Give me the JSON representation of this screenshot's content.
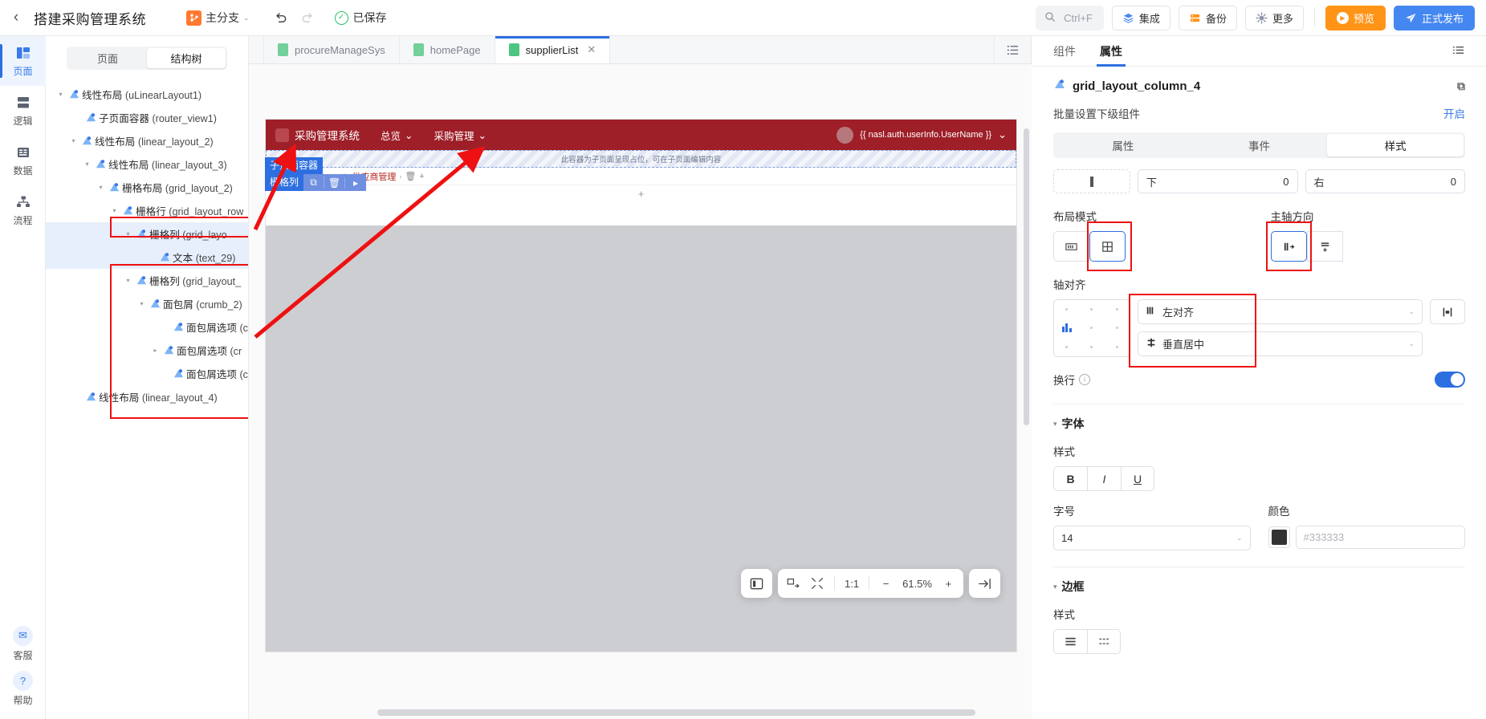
{
  "topbar": {
    "back_icon": "chevron-left-icon",
    "project_title": "搭建采购管理系统",
    "branch_label": "主分支",
    "branch_caret": "⌄",
    "undo_icon": "↺",
    "redo_icon": "↻",
    "saved_label": "已保存",
    "saved_check": "✓",
    "search": {
      "icon": "search-icon",
      "shortcut": "Ctrl+F"
    },
    "buttons": [
      {
        "name": "integration",
        "label": "集成"
      },
      {
        "name": "backup",
        "label": "备份"
      },
      {
        "name": "more",
        "label": "更多"
      }
    ],
    "preview_label": "预览",
    "publish_label": "正式发布"
  },
  "rail": {
    "items": [
      {
        "label": "页面",
        "icon": "pages-icon",
        "active": true
      },
      {
        "label": "逻辑",
        "icon": "logic-icon",
        "active": false
      },
      {
        "label": "数据",
        "icon": "data-icon",
        "active": false
      },
      {
        "label": "流程",
        "icon": "flow-icon",
        "active": false
      }
    ],
    "bottom": [
      {
        "label": "客服",
        "icon": "support-icon"
      },
      {
        "label": "帮助",
        "icon": "help-icon"
      }
    ]
  },
  "tree_panel": {
    "tabs": [
      {
        "label": "页面",
        "active": false
      },
      {
        "label": "结构树",
        "active": true
      }
    ],
    "nodes": [
      {
        "indent": 0,
        "twisty": "▾",
        "label": "线性布局",
        "id": "(uLinearLayout1)",
        "selected": false
      },
      {
        "indent": 1,
        "twisty": "",
        "label": "子页面容器",
        "id": "(router_view1)",
        "selected": false
      },
      {
        "indent": 1,
        "twisty": "▾",
        "label": "线性布局",
        "id": "(linear_layout_2)",
        "selected": false
      },
      {
        "indent": 2,
        "twisty": "▾",
        "label": "线性布局",
        "id": "(linear_layout_3)",
        "selected": false
      },
      {
        "indent": 3,
        "twisty": "▾",
        "label": "栅格布局",
        "id": "(grid_layout_2)",
        "selected": false
      },
      {
        "indent": 4,
        "twisty": "▾",
        "label": "栅格行",
        "id": "(grid_layout_row",
        "selected": false
      },
      {
        "indent": 5,
        "twisty": "▾",
        "label": "栅格列",
        "id": "(grid_layo",
        "selected": true
      },
      {
        "indent": 6,
        "twisty": "",
        "label": "文本",
        "id": "(text_29)",
        "selected": true
      },
      {
        "indent": 5,
        "twisty": "▾",
        "label": "栅格列",
        "id": "(grid_layout_",
        "selected": false
      },
      {
        "indent": 6,
        "twisty": "▾",
        "label": "面包屑",
        "id": "(crumb_2)",
        "selected": false
      },
      {
        "indent": 7,
        "twisty": "",
        "label": "面包屑选项",
        "id": "(cr",
        "selected": false
      },
      {
        "indent": 7,
        "twisty": "▸",
        "label": "面包屑选项",
        "id": "(cr",
        "selected": false
      },
      {
        "indent": 7,
        "twisty": "",
        "label": "面包屑选项",
        "id": "(cr",
        "selected": false
      },
      {
        "indent": 1,
        "twisty": "",
        "label": "线性布局",
        "id": "(linear_layout_4)",
        "selected": false
      }
    ]
  },
  "file_tabs": {
    "items": [
      {
        "label": "procureManageSys",
        "active": false,
        "closable": false
      },
      {
        "label": "homePage",
        "active": false,
        "closable": false
      },
      {
        "label": "supplierList",
        "active": true,
        "closable": true,
        "close_icon": "close-icon"
      }
    ],
    "list_icon": "list-view-icon"
  },
  "canvas": {
    "app_nav": {
      "brand": "采购管理系统",
      "links": [
        {
          "label": "总览",
          "caret": "⌄"
        },
        {
          "label": "采购管理",
          "caret": "⌄"
        }
      ],
      "user_expr": "{{ nasl.auth.userInfo.UserName }}",
      "user_caret": "⌄"
    },
    "router_placeholder_text": "此容器为子页面呈现占位，可在子页面编辑内容",
    "overlay_badges": {
      "router_view": "子页面容器",
      "grid_column": "栅格列"
    },
    "toolstrip_icons": [
      "copy-icon",
      "delete-icon",
      "more-arrow-icon"
    ],
    "breadcrumb": {
      "chip": "采购管理",
      "items": [
        "供应商管理"
      ],
      "home_icon": "home-icon",
      "person_icon": "person-icon",
      "trash_icon": "trash-icon",
      "plus": "+",
      "sep": "›"
    },
    "add_row_plus": "+",
    "zoom_toolbar": {
      "panel_icon": "panel-toggle-icon",
      "fit_icon": "fit-screen-icon",
      "collapse_icon": "collapse-icon",
      "ratio_label": "1:1",
      "minus": "−",
      "zoom_level": "61.5%",
      "plus": "+",
      "expand_icon": "expand-right-icon"
    }
  },
  "right_panel": {
    "tabs": [
      {
        "label": "组件",
        "active": false
      },
      {
        "label": "属性",
        "active": true
      }
    ],
    "collapse_icon": "collapse-panel-icon",
    "component_name": "grid_layout_column_4",
    "copy_icon": "copy-icon",
    "batch_label": "批量设置下级组件",
    "batch_action": "开启",
    "subtabs": [
      {
        "label": "属性",
        "active": false
      },
      {
        "label": "事件",
        "active": false
      },
      {
        "label": "样式",
        "active": true
      }
    ],
    "padding": [
      {
        "label": "下",
        "value": "0"
      },
      {
        "label": "右",
        "value": "0"
      }
    ],
    "layout_mode": {
      "label": "布局模式",
      "options": [
        "inline-icon",
        "grid-icon"
      ],
      "selected_index": 1
    },
    "main_axis": {
      "label": "主轴方向",
      "options": [
        "horizontal-icon",
        "vertical-icon"
      ],
      "selected_index": 0
    },
    "axis_align": {
      "label": "轴对齐",
      "main_value": "左对齐",
      "main_icon": "align-left-icon",
      "cross_value": "垂直居中",
      "cross_icon": "align-middle-icon",
      "side_button_icon": "stretch-icon"
    },
    "wrap": {
      "label": "换行",
      "info_icon": "info-icon",
      "enabled": true
    },
    "font_section": {
      "title": "字体",
      "twisty": "▾",
      "style_label": "样式",
      "style_buttons": [
        "B",
        "I",
        "U"
      ],
      "size_label": "字号",
      "size_value": "14",
      "color_label": "颜色",
      "color_value": "#333333",
      "color_placeholder": "#333333"
    },
    "border_section": {
      "title": "边框",
      "twisty": "▾",
      "style_label": "样式",
      "buttons": [
        "border-all-icon",
        "border-dashed-icon"
      ]
    }
  },
  "colors": {
    "accent": "#2d6fe0",
    "orange": "#ff9417",
    "publish_blue": "#4587f0",
    "app_nav_red": "#9e1f28",
    "highlight_red": "#ee1111",
    "canvas_grey": "#cdced2"
  }
}
